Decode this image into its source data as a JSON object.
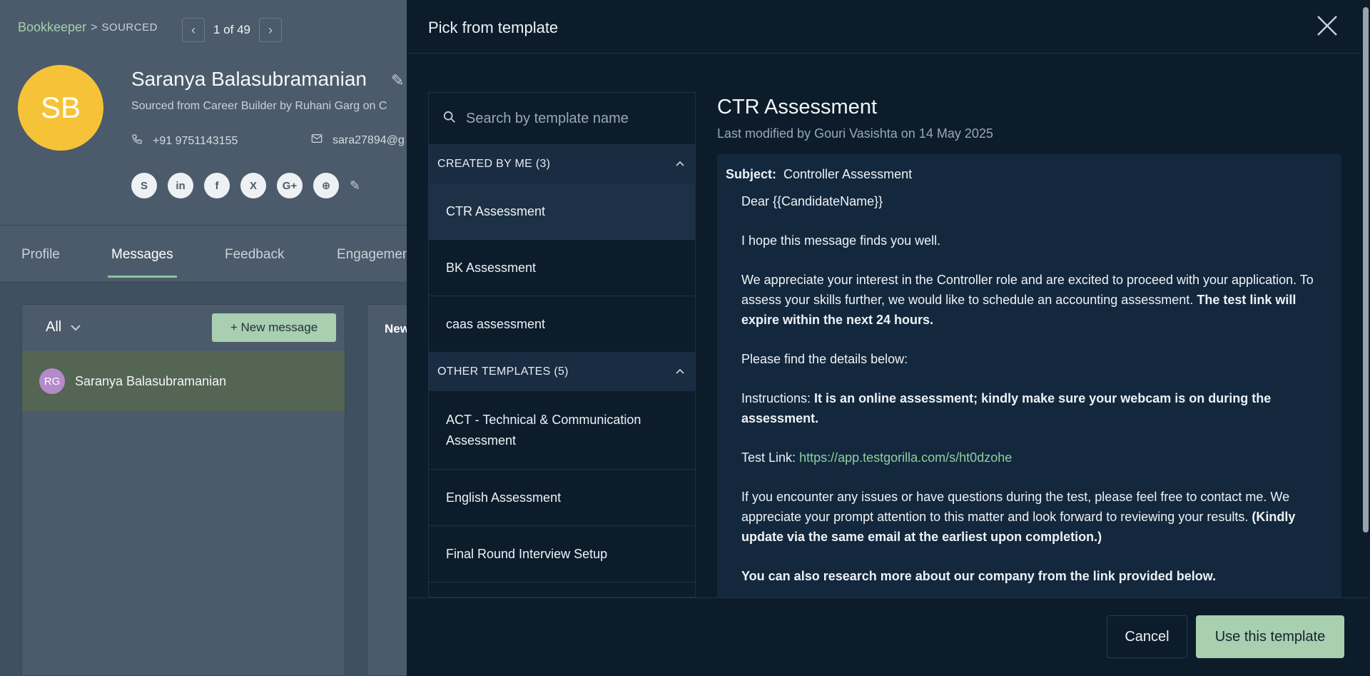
{
  "background": {
    "breadcrumb": {
      "job": "Bookkeeper",
      "separator": ">",
      "stage": "SOURCED"
    },
    "pager": {
      "prev": "‹",
      "text": "1 of 49",
      "next": "›"
    },
    "candidate": {
      "initials": "SB",
      "name": "Saranya Balasubramanian",
      "source": "Sourced from Career Builder by Ruhani Garg on C",
      "phone": "+91 9751143155",
      "email": "sara27894@g",
      "avatar_color": "#f6c338"
    },
    "socials": [
      "S",
      "in",
      "f",
      "X",
      "G+",
      "⊕"
    ],
    "tabs": [
      "Profile",
      "Messages",
      "Feedback",
      "Engagemen"
    ],
    "messages": {
      "filter": "All",
      "new_button": "+ New message",
      "thread": {
        "initials": "RG",
        "name": "Saranya Balasubramanian"
      },
      "conv_label": "New"
    }
  },
  "modal": {
    "title": "Pick from template",
    "search_placeholder": "Search by template name",
    "groups": [
      {
        "label": "CREATED BY ME (3)",
        "items": [
          "CTR Assessment",
          "BK Assessment",
          "caas assessment"
        ]
      },
      {
        "label": "OTHER TEMPLATES (5)",
        "items": [
          "ACT - Technical & Communication Assessment",
          "English Assessment",
          "Final Round Interview Setup"
        ]
      }
    ],
    "preview": {
      "title": "CTR Assessment",
      "meta": "Last modified by Gouri Vasishta on 14 May 2025",
      "subject_label": "Subject:",
      "subject": "Controller Assessment",
      "greeting": "Dear {{CandidateName}}",
      "p1": "I hope this message finds you well.",
      "p2": "We appreciate your interest in the Controller role and are excited to proceed with your application. To assess your skills further, we would like to schedule an accounting assessment.",
      "p2_bold": "The test link will expire within the next 24 hours.",
      "p3": "Please find the details below:",
      "p4_label": "Instructions:",
      "p4_bold": " It is an online assessment; kindly make sure your webcam is on during the assessment.",
      "p5_label": "Test Link:",
      "p5_link": "https://app.testgorilla.com/s/ht0dzohe",
      "p6": "If you encounter any issues or have questions during the test, please feel free to contact me. We appreciate your prompt attention to this matter and look forward to reviewing your results.",
      "p6_bold": "(Kindly update via the same email at the earliest upon completion.)",
      "p7_bold": "You can also research more about our company from the link provided below."
    },
    "cancel": "Cancel",
    "use": "Use this template"
  }
}
